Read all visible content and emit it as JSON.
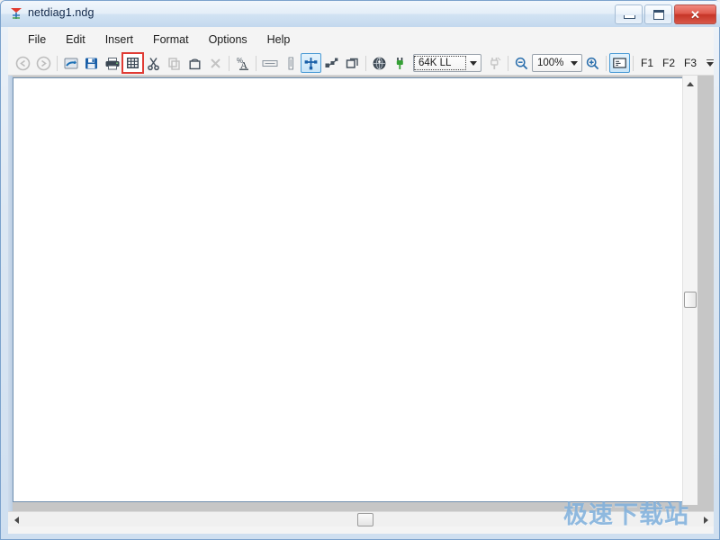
{
  "window": {
    "title": "netdiag1.ndg",
    "icon": "app-icon",
    "controls": {
      "minimize": "minimize",
      "maximize": "maximize",
      "close": "✕"
    }
  },
  "menubar": {
    "items": [
      {
        "label": "File"
      },
      {
        "label": "Edit"
      },
      {
        "label": "Insert"
      },
      {
        "label": "Format"
      },
      {
        "label": "Options"
      },
      {
        "label": "Help"
      }
    ]
  },
  "toolbar": {
    "buttons": [
      {
        "name": "back-icon",
        "state": "disabled"
      },
      {
        "name": "forward-icon",
        "state": "disabled"
      },
      {
        "name": "open-icon",
        "state": "normal"
      },
      {
        "name": "save-icon",
        "state": "normal"
      },
      {
        "name": "print-icon",
        "state": "normal"
      },
      {
        "name": "rack-device-icon",
        "state": "highlighted"
      },
      {
        "name": "cut-icon",
        "state": "normal"
      },
      {
        "name": "copy-icon",
        "state": "disabled"
      },
      {
        "name": "paste-icon",
        "state": "normal"
      },
      {
        "name": "delete-icon",
        "state": "disabled"
      },
      {
        "name": "text-format-icon",
        "state": "normal"
      },
      {
        "name": "label-icon",
        "state": "normal"
      },
      {
        "name": "vertical-bar-icon",
        "state": "normal"
      },
      {
        "name": "node-crosshair-icon",
        "state": "selected"
      },
      {
        "name": "network-group-icon",
        "state": "normal"
      },
      {
        "name": "duplicate-shape-icon",
        "state": "normal"
      },
      {
        "name": "globe-icon",
        "state": "normal"
      },
      {
        "name": "connector-icon",
        "state": "normal"
      }
    ],
    "link_type": {
      "value": "64K LL",
      "placeholder": "64K LL"
    },
    "link_tool_icon": "link-tool-icon",
    "zoom_out_icon": "zoom-out-icon",
    "zoom": {
      "value": "100%",
      "placeholder": "100%"
    },
    "zoom_in_icon": "zoom-in-icon",
    "note_icon": "note-icon",
    "function_keys": [
      {
        "label": "F1"
      },
      {
        "label": "F2"
      },
      {
        "label": "F3"
      }
    ],
    "overflow_label": "toolbar-overflow"
  },
  "document": {
    "canvas_name": "diagram-canvas",
    "background_color": "#ffffff",
    "frame_color": "#6f8eae"
  },
  "scrollbars": {
    "vertical": {
      "up_arrow": "scroll-up-arrow",
      "thumb": "vertical-thumb"
    },
    "horizontal": {
      "left_arrow": "scroll-left-arrow",
      "right_arrow": "scroll-right-arrow",
      "thumb": "horizontal-thumb"
    }
  },
  "watermark": {
    "text": "极速下载站",
    "color": "#7fb0dd"
  }
}
